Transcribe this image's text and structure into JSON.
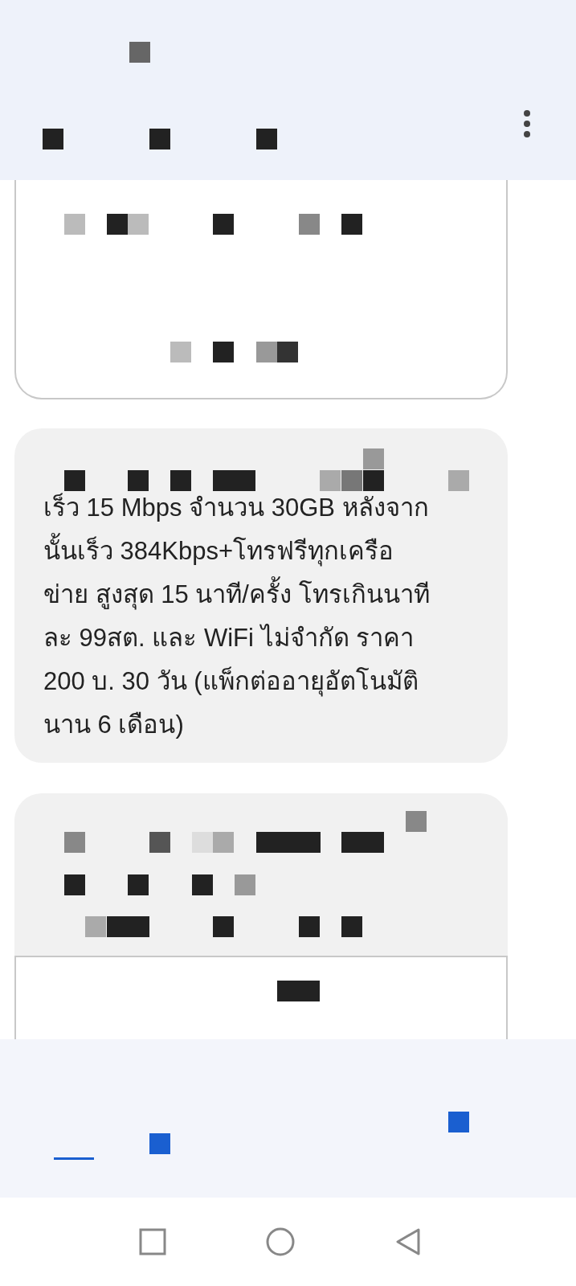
{
  "messages": [
    {
      "kind": "card"
    },
    {
      "kind": "bubble",
      "lines": [
        "เร็ว 15 Mbps จำนวน 30GB หลังจาก",
        "นั้นเร็ว 384Kbps+โทรฟรีทุกเครือ",
        "ข่าย สูงสุด 15 นาที/ครั้ง โทรเกินนาที",
        "ละ 99สต. และ WiFi ไม่จำกัด ราคา",
        "200 บ. 30 วัน (แพ็กต่ออายุอัตโนมัติ",
        "นาน 6 เดือน)"
      ]
    },
    {
      "kind": "bubble_card"
    }
  ],
  "bottom_tabs": [
    {
      "selected": true
    }
  ]
}
